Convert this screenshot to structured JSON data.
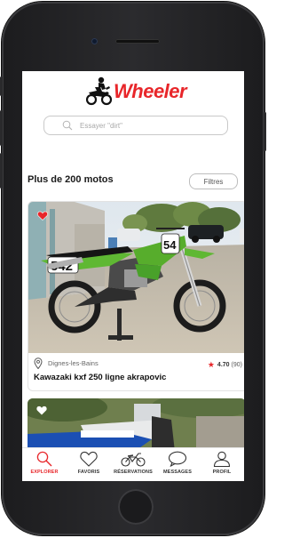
{
  "app": {
    "brand": "Wheeler",
    "accent_color": "#e8262a"
  },
  "search": {
    "placeholder": "Essayer \"dirt\""
  },
  "listings_header": {
    "count_text": "Plus de 200 motos",
    "filters_label": "Filtres"
  },
  "listings": [
    {
      "location": "Dignes-les-Bains",
      "title": "Kawazaki kxf 250 ligne akrapovic",
      "rating": "4.70",
      "reviews": "(90)",
      "favorited": true,
      "plate_number": "542",
      "side_number": "54"
    }
  ],
  "tabs": [
    {
      "label": "EXPLORER",
      "icon": "search-icon",
      "active": true
    },
    {
      "label": "FAVORIS",
      "icon": "heart-icon",
      "active": false
    },
    {
      "label": "RÉSERVATIONS",
      "icon": "motorbike-icon",
      "active": false
    },
    {
      "label": "MESSAGES",
      "icon": "chat-bubble-icon",
      "active": false
    },
    {
      "label": "PROFIL",
      "icon": "user-icon",
      "active": false
    }
  ]
}
